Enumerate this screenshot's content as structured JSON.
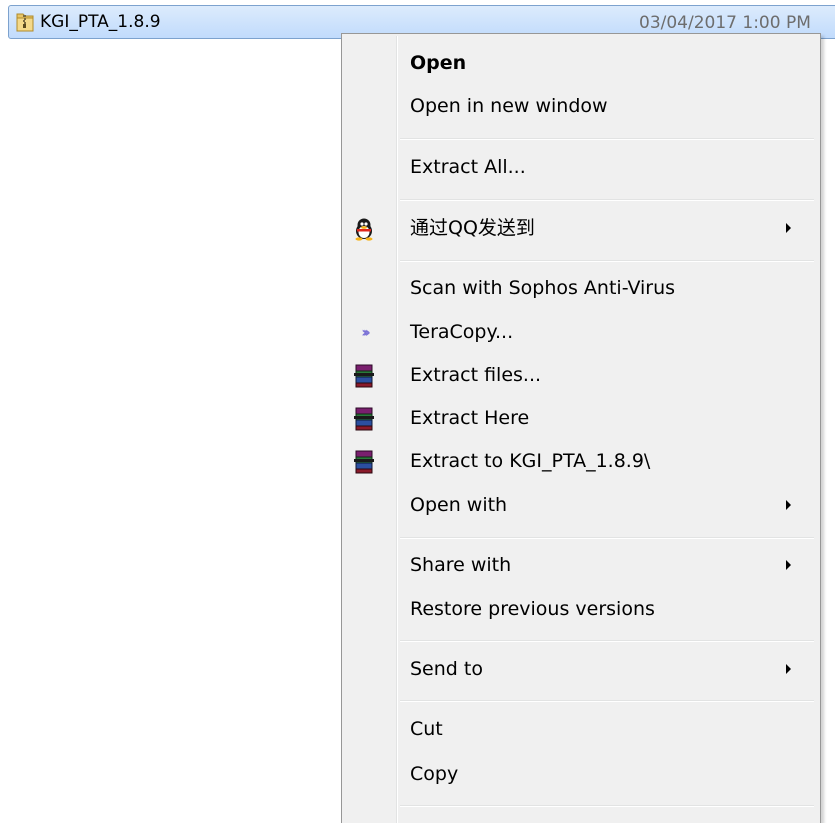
{
  "file": {
    "name": "KGI_PTA_1.8.9",
    "date": "03/04/2017 1:00 PM",
    "icon": "zip-folder-icon"
  },
  "menu": {
    "items": [
      {
        "label": "Open",
        "bold": true
      },
      {
        "label": "Open in new window"
      },
      {
        "label": "Extract All..."
      },
      {
        "label": "通过QQ发送到",
        "icon": "qq-penguin-icon",
        "submenu": true
      },
      {
        "label": "Scan with Sophos Anti-Virus"
      },
      {
        "label": "TeraCopy...",
        "icon": "teracopy-icon"
      },
      {
        "label": "Extract files...",
        "icon": "winrar-icon"
      },
      {
        "label": "Extract Here",
        "icon": "winrar-icon"
      },
      {
        "label": "Extract to KGI_PTA_1.8.9\\",
        "icon": "winrar-icon"
      },
      {
        "label": "Open with",
        "submenu": true
      },
      {
        "label": "Share with",
        "submenu": true
      },
      {
        "label": "Restore previous versions"
      },
      {
        "label": "Send to",
        "submenu": true
      },
      {
        "label": "Cut"
      },
      {
        "label": "Copy"
      }
    ]
  },
  "colors": {
    "selection": "#c1dbfc",
    "menu_bg": "#f0f0f0",
    "teracopy": "#7b72d6"
  }
}
